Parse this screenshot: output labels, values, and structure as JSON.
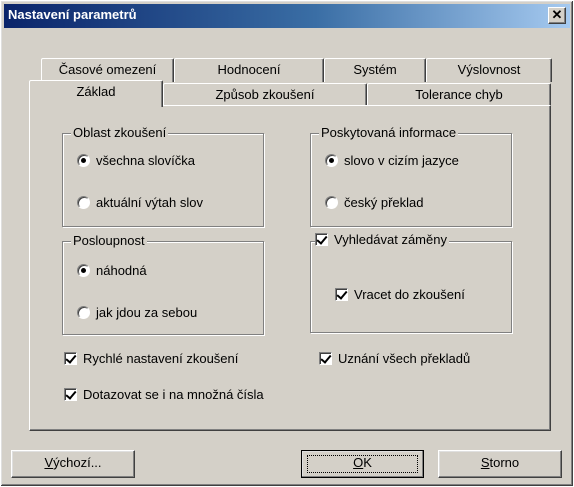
{
  "window": {
    "title": "Nastavení parametrů",
    "close_glyph": "✕"
  },
  "tabs_back": [
    "Časové omezení",
    "Hodnocení",
    "Systém",
    "Výslovnost"
  ],
  "tabs_front": [
    "Základ",
    "Způsob zkoušení",
    "Tolerance chyb"
  ],
  "active_tab": "Základ",
  "groups": {
    "oblast": {
      "title": "Oblast zkoušení",
      "options": [
        {
          "label": "všechna slovíčka",
          "checked": true
        },
        {
          "label": "aktuální výtah slov",
          "checked": false
        }
      ]
    },
    "poskytovana": {
      "title": "Poskytovaná informace",
      "options": [
        {
          "label": "slovo v cizím jazyce",
          "checked": true
        },
        {
          "label": "český překlad",
          "checked": false
        }
      ]
    },
    "posloupnost": {
      "title": "Posloupnost",
      "options": [
        {
          "label": "náhodná",
          "checked": true
        },
        {
          "label": "jak jdou za sebou",
          "checked": false
        }
      ]
    },
    "vyhledavat": {
      "title": "Vyhledávat záměny",
      "checked": true,
      "sub": {
        "label": "Vracet do zkoušení",
        "checked": true
      }
    }
  },
  "checkboxes": {
    "rychle": {
      "label": "Rychlé nastavení zkoušení",
      "checked": true
    },
    "uznani": {
      "label": "Uznání všech překladů",
      "checked": true
    },
    "dotazovat": {
      "label": "Dotazovat se i na množná čísla",
      "checked": true
    }
  },
  "buttons": {
    "vychozi": {
      "mnemonic": "V",
      "rest": "ýchozí..."
    },
    "ok": {
      "mnemonic": "O",
      "rest": "K"
    },
    "storno": {
      "mnemonic": "S",
      "rest": "torno"
    }
  }
}
